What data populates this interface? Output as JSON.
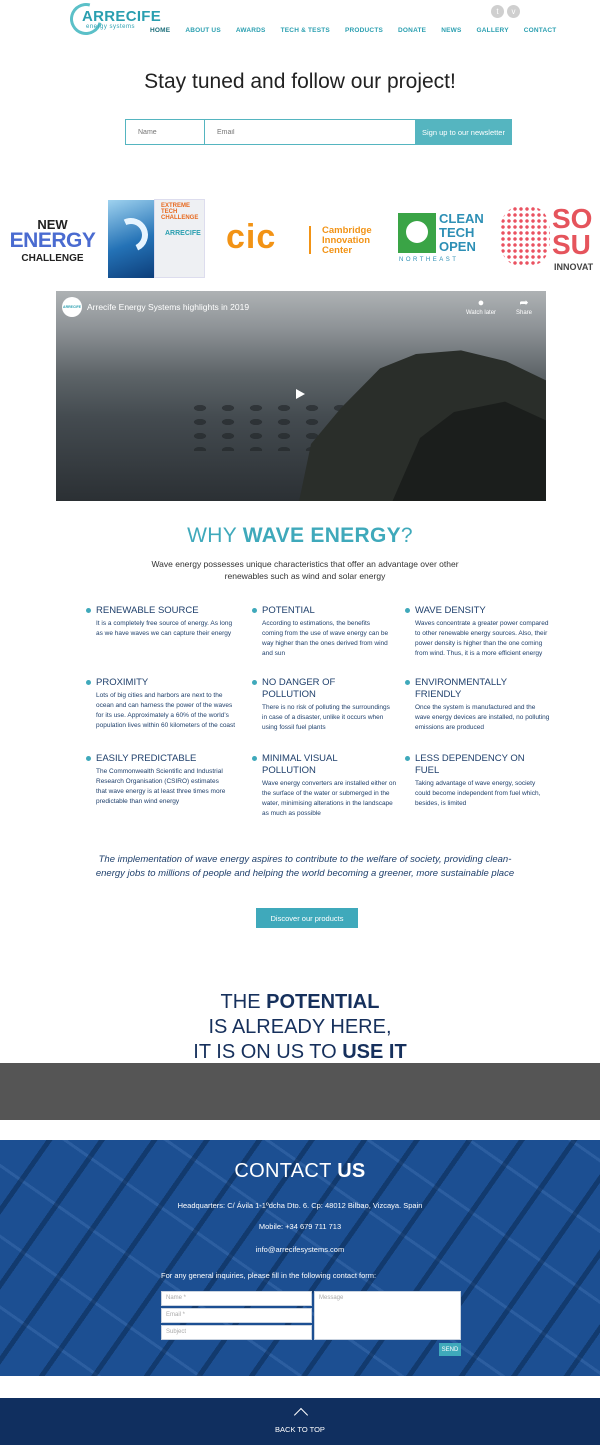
{
  "header": {
    "logo_text": "ARRECIFE",
    "logo_sub": "energy systems",
    "nav": [
      "HOME",
      "ABOUT US",
      "AWARDS",
      "TECH & TESTS",
      "PRODUCTS",
      "DONATE",
      "NEWS",
      "GALLERY",
      "CONTACT"
    ]
  },
  "newsletter": {
    "headline": "Stay tuned and follow our project!",
    "name_placeholder": "Name",
    "email_placeholder": "Email",
    "button": "Sign up to our newsletter"
  },
  "partners": {
    "newenergy": [
      "NEW",
      "ENERGY",
      "CHALLENGE"
    ],
    "xtreme": "EXTREME TECH CHALLENGE",
    "cic": {
      "mark": "cic",
      "text": [
        "Cambridge",
        "Innovation",
        "Center"
      ]
    },
    "cleantech": {
      "text": [
        "CLEAN",
        "TECH",
        "OPEN"
      ],
      "sub": "NORTHEAST"
    },
    "solve": {
      "text": [
        "SO",
        "SU"
      ],
      "sub": "INNOVAT"
    }
  },
  "video": {
    "title": "Arrecife Energy Systems highlights in 2019",
    "watch_later": "Watch later",
    "share": "Share"
  },
  "why": {
    "title_plain": "WHY ",
    "title_bold": "WAVE ENERGY",
    "title_end": "?",
    "subtitle": "Wave energy possesses unique characteristics that offer an advantage over other renewables such as wind and solar energy",
    "features": [
      {
        "title": "RENEWABLE SOURCE",
        "desc": "It is a completely free source of energy. As long as we have waves we can capture their energy"
      },
      {
        "title": "POTENTIAL",
        "desc": "According to estimations, the benefits coming from the use of wave energy can be way higher than the ones derived from wind and sun"
      },
      {
        "title": "WAVE DENSITY",
        "desc": "Waves concentrate a greater power compared to other renewable energy sources. Also, their power density is higher than the one coming from wind. Thus, it is a more efficient energy"
      },
      {
        "title": "PROXIMITY",
        "desc": "Lots of big cities and harbors are next to the ocean and can harness the power of the waves for its use. Approximately a 60% of the world’s population lives within 60 kilometers of the coast"
      },
      {
        "title": "NO DANGER OF POLLUTION",
        "desc": "There is no risk of polluting the surroundings in case of a disaster, unlike it occurs when using fossil fuel plants"
      },
      {
        "title": "ENVIRONMENTALLY FRIENDLY",
        "desc": "Once the system is manufactured and the wave energy devices are installed, no polluting emissions are produced"
      },
      {
        "title": "EASILY PREDICTABLE",
        "desc": "The Commonwealth Scientific and Industrial Research Organisation (CSIRO) estimates that wave energy is at least three times more predictable than wind energy"
      },
      {
        "title": "MINIMAL VISUAL POLLUTION",
        "desc": "Wave energy converters are installed either on the surface of the water or submerged in the water, minimising alterations in the landscape as much as possible"
      },
      {
        "title": "LESS DEPENDENCY ON FUEL",
        "desc": "Taking advantage of wave energy, society could become independent from fuel which, besides, is limited"
      }
    ],
    "quote": "The implementation of wave energy aspires to contribute to the welfare of society, providing clean-energy jobs to millions of people and helping the world becoming a greener, more sustainable place",
    "button": "Discover our products"
  },
  "potential": {
    "l1a": "THE ",
    "l1b": "POTENTIAL",
    "l2": "IS ALREADY HERE,",
    "l3a": "IT IS ON US TO ",
    "l3b": "USE IT"
  },
  "contact": {
    "title_plain": "CONTACT ",
    "title_bold": "US",
    "address": "Headquarters: C/ Ávila 1-1ºdcha Dto. 6. Cp: 48012 Bilbao, Vizcaya. Spain",
    "mobile": "Mobile: +34 679 711 713",
    "email": "info@arrecifesystems.com",
    "form_label": "For any general inquiries, please fill in the following contact form:",
    "name_ph": "Name *",
    "email_ph": "Email *",
    "subject_ph": "Subject",
    "message_ph": "Message",
    "send": "SEND"
  },
  "footer": {
    "back_to_top": "BACK TO TOP"
  }
}
